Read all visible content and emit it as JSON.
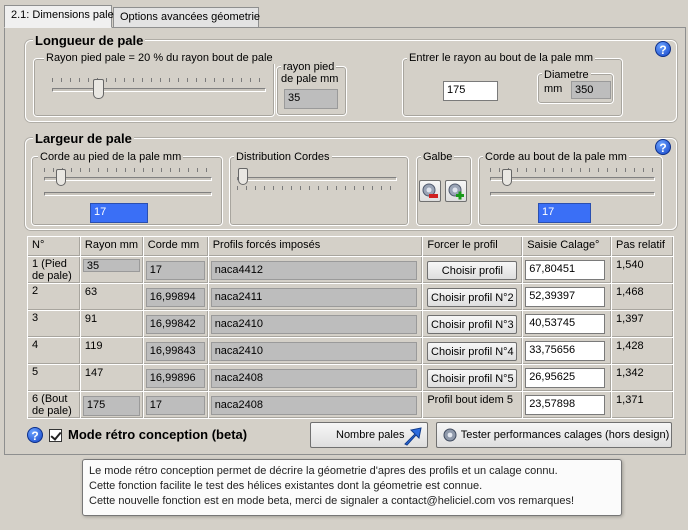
{
  "tabs": [
    {
      "label": "2.1: Dimensions pale",
      "active": true
    },
    {
      "label": "Options avancées géometrie",
      "active": false
    }
  ],
  "longueur": {
    "title": "Longueur de pale",
    "rayon_pied_group_label": "Rayon pied pale = 20 % du rayon bout de pale",
    "rayon_pied_mm_label_1": "rayon pied",
    "rayon_pied_mm_label_2": "de pale mm",
    "rayon_pied_value": "35",
    "rayon_bout_label": "Entrer le rayon au bout de la pale mm",
    "rayon_bout_value": "175",
    "diametre_label": "Diametre",
    "diametre_unit": "mm",
    "diametre_value": "350"
  },
  "largeur": {
    "title": "Largeur de pale",
    "corde_pied_label": "Corde au pied de la pale mm",
    "corde_pied_value": "17",
    "distribution_label": "Distribution  Cordes",
    "galbe_label": "Galbe",
    "corde_bout_label": "Corde au bout de la pale mm",
    "corde_bout_value": "17"
  },
  "table": {
    "headers": [
      "N°",
      "Rayon mm",
      "Corde mm",
      "Profils forcés imposés",
      "Forcer le profil",
      "Saisie Calage°",
      "Pas relatif"
    ],
    "rows": [
      {
        "n": "1 (Pied de pale)",
        "rayon": "35",
        "corde": "17",
        "profil": "naca4412",
        "forcer": "Choisir profil",
        "calage": "67,80451",
        "pas": "1,540"
      },
      {
        "n": "2",
        "rayon": "63",
        "corde": "16,99894",
        "profil": "naca2411",
        "forcer": "Choisir profil N°2",
        "calage": "52,39397",
        "pas": "1,468"
      },
      {
        "n": "3",
        "rayon": "91",
        "corde": "16,99842",
        "profil": "naca2410",
        "forcer": "Choisir profil N°3",
        "calage": "40,53745",
        "pas": "1,397"
      },
      {
        "n": "4",
        "rayon": "119",
        "corde": "16,99843",
        "profil": "naca2410",
        "forcer": "Choisir profil N°4",
        "calage": "33,75656",
        "pas": "1,428"
      },
      {
        "n": "5",
        "rayon": "147",
        "corde": "16,99896",
        "profil": "naca2408",
        "forcer": "Choisir profil N°5",
        "calage": "26,95625",
        "pas": "1,342"
      },
      {
        "n": "6 (Bout de pale)",
        "rayon": "175",
        "corde": "17",
        "profil": "naca2408",
        "forcer": "Profil bout idem 5",
        "calage": "23,57898",
        "pas": "1,371"
      }
    ]
  },
  "bottom": {
    "retro_label": "Mode rétro conception (beta)",
    "retro_checked": true,
    "nombre_pales_label": "Nombre pales",
    "tester_label": "Tester performances calages (hors design)"
  },
  "tooltip": {
    "line1": "Le mode rétro conception permet de décrire la géometrie d'apres des profils et un calage connu.",
    "line2": "Cette fonction facilite le test des hélices existantes dont la géometrie est connue.",
    "line3": "Cette nouvelle fonction est en mode beta, merci de signaler a contact@heliciel.com vos remarques!"
  },
  "icons": {
    "help": "help-icon",
    "galbe_minus": "gear-minus-icon",
    "galbe_plus": "gear-plus-icon",
    "nombre_pales": "arrow-icon",
    "tester": "gear-icon"
  },
  "colors": {
    "selection": "#3a6ff6",
    "help": "#1646c8"
  }
}
